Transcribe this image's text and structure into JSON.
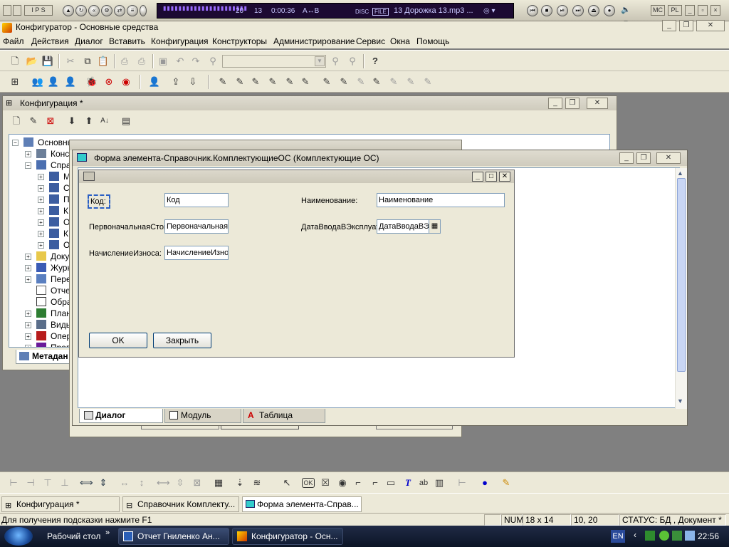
{
  "media_player": {
    "time": "0:00:36",
    "track_number": "20",
    "bitrate": "13",
    "ab_label": "A↔B",
    "disc_label": "DISC",
    "file_label": "FILE",
    "track_title": "13 Дорожка 13.mp3 ...",
    "mc_label": "MC",
    "pl_label": "PL"
  },
  "app": {
    "title": "Конфигуратор - Основные средства"
  },
  "menu": {
    "items": [
      "Файл",
      "Действия",
      "Диалог",
      "Вставить",
      "Конфигурация",
      "Конструкторы",
      "Администрирование",
      "Сервис",
      "Окна",
      "Помощь"
    ]
  },
  "config_window": {
    "title": "Конфигурация *",
    "tree": [
      {
        "label": "Основные средства"
      },
      {
        "label": "Конс"
      },
      {
        "label": "Спра"
      },
      {
        "label": "М"
      },
      {
        "label": "С"
      },
      {
        "label": "П"
      },
      {
        "label": "К"
      },
      {
        "label": "О"
      },
      {
        "label": "К"
      },
      {
        "label": "О"
      },
      {
        "label": "Доку"
      },
      {
        "label": "Журн"
      },
      {
        "label": "Пере"
      },
      {
        "label": "Отчет"
      },
      {
        "label": "Обра"
      },
      {
        "label": "План"
      },
      {
        "label": "Виды"
      },
      {
        "label": "Опер"
      },
      {
        "label": "Пров"
      }
    ],
    "metadata_tab": "Метадан"
  },
  "form_window": {
    "title": "Форма элемента-Справочник.КомплектующиеОС (Комплектующие ОС)",
    "fields": {
      "code_label": "Код:",
      "code_value": "Код",
      "name_label": "Наименование:",
      "name_value": "Наименование",
      "initial_cost_label": "ПервоначальнаяСтоимость:",
      "initial_cost_value": "ПервоначальнаяСтоимость",
      "commission_date_label": "ДатаВводаВЭксплуатацию:",
      "commission_date_value": "ДатаВводаВЭксплуатацию",
      "depreciation_label": "НачислениеИзноса:",
      "depreciation_value": "НачислениеИзноса"
    },
    "ok_button": "OK",
    "close_button": "Закрыть",
    "tabs": [
      "Диалог",
      "Модуль",
      "Таблица"
    ]
  },
  "window_tabs": [
    "Конфигурация *",
    "Справочник Комплекту...",
    "Форма элемента-Справ..."
  ],
  "status_bar": {
    "hint": "Для получения подсказки нажмите F1",
    "num": "NUM",
    "size": "18 x 14",
    "position": "10, 20",
    "status": "СТАТУС: БД , Документ *"
  },
  "taskbar": {
    "desktop": "Рабочий стол",
    "tasks": [
      "Отчет Гниленко Ан...",
      "Конфигуратор - Осн..."
    ],
    "lang": "EN",
    "clock": "22:56"
  }
}
